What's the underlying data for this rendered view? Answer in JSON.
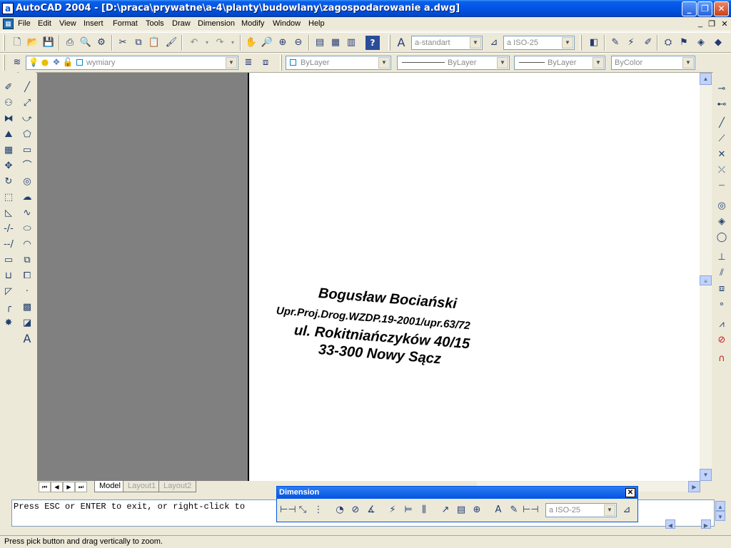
{
  "window": {
    "app_icon": "a",
    "title": "AutoCAD 2004 - [D:\\praca\\prywatne\\a-4\\planty\\budowlany\\zagospodarowanie a.dwg]",
    "btn_min": "_",
    "btn_max": "❐",
    "btn_close": "✕"
  },
  "menu": {
    "items": [
      "File",
      "Edit",
      "View",
      "Insert",
      "Format",
      "Tools",
      "Draw",
      "Dimension",
      "Modify",
      "Window",
      "Help"
    ],
    "mdi": [
      "_",
      "❐",
      "✕"
    ]
  },
  "toolbar": {
    "text_style": "a-standart",
    "dim_style": "a ISO-25",
    "layer": "wymiary",
    "color": "ByLayer",
    "linetype": "ByLayer",
    "lineweight": "ByLayer",
    "plotstyle": "ByColor"
  },
  "drawing": {
    "lines": [
      "Bogusław Bociański",
      "Upr.Proj.Drog.WZDP.19-2001/upr.63/72",
      "ul. Rokitniańczyków 40/15",
      "33-300 Nowy Sącz"
    ]
  },
  "layout_tabs": [
    "Model",
    "Layout1",
    "Layout2"
  ],
  "command_line": "Press ESC or ENTER to exit, or right-click to",
  "status": "Press pick button and drag vertically to zoom.",
  "dimension_toolbar": {
    "title": "Dimension",
    "close": "✕",
    "style": "a ISO-25"
  }
}
